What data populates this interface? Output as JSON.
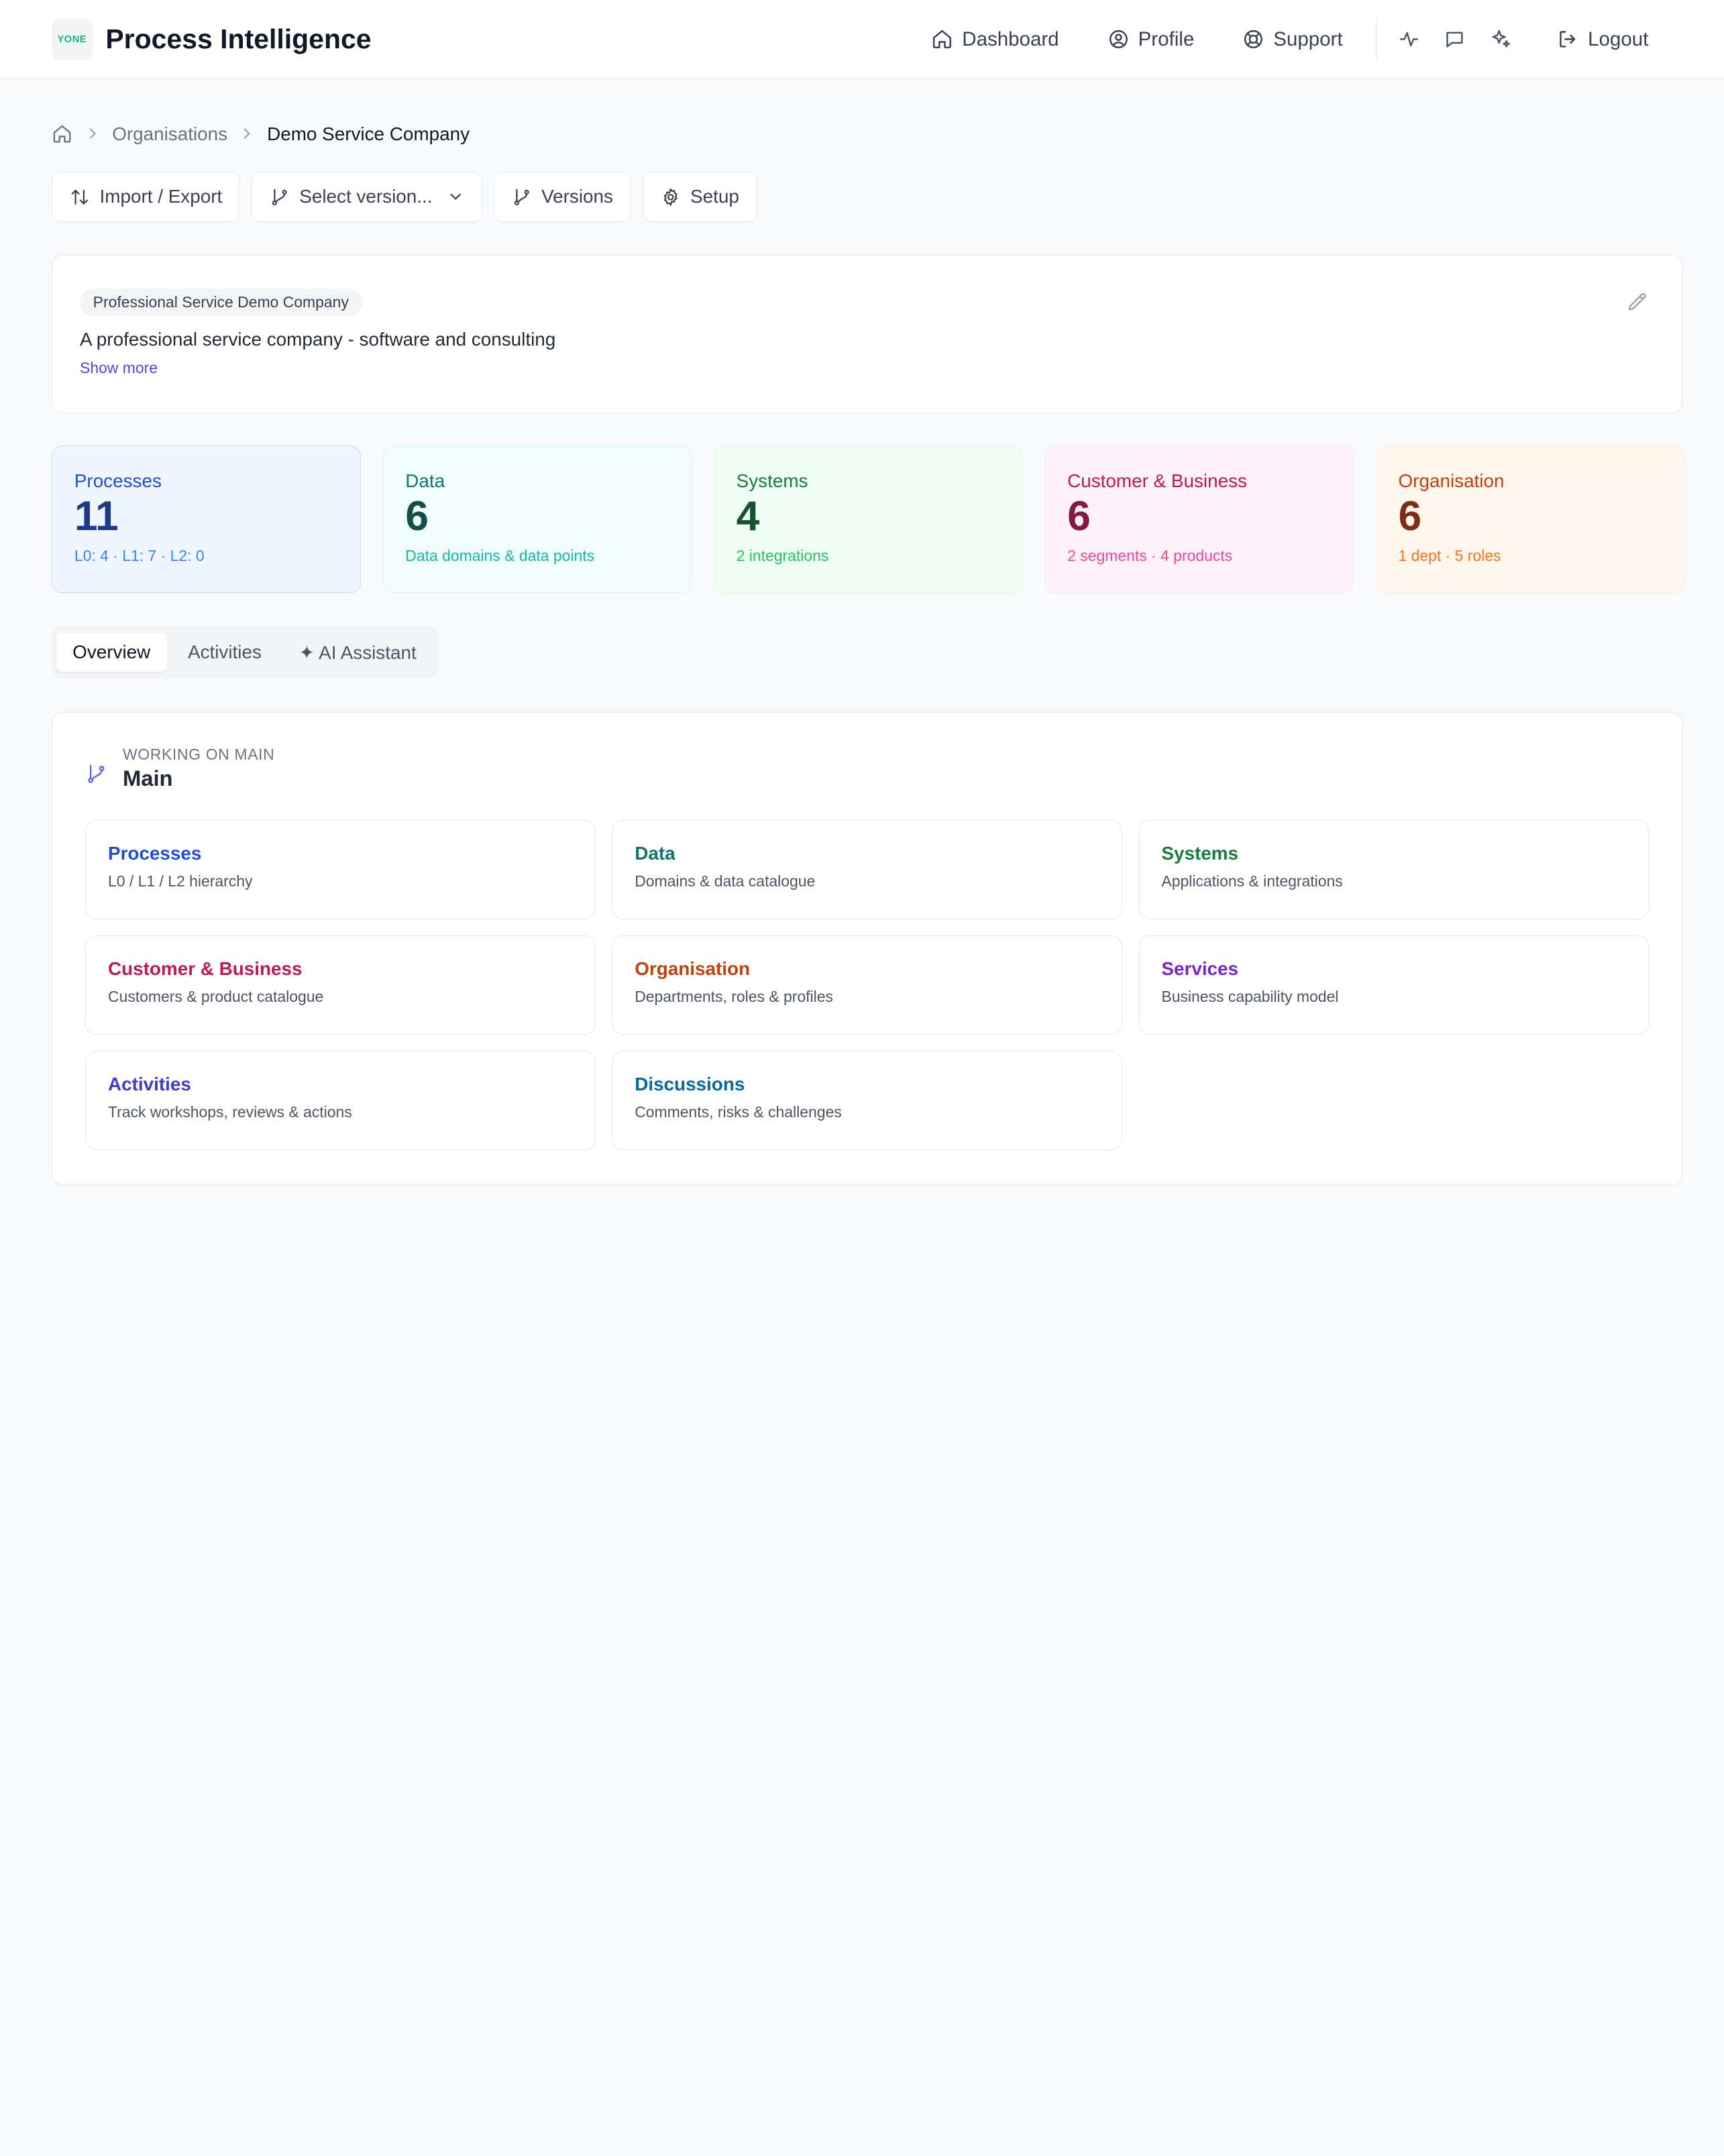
{
  "header": {
    "logo_text": "YONE",
    "title": "Process Intelligence",
    "nav": {
      "dashboard": "Dashboard",
      "profile": "Profile",
      "support": "Support",
      "logout": "Logout"
    }
  },
  "breadcrumb": {
    "organisations": "Organisations",
    "current": "Demo Service Company"
  },
  "toolbar": {
    "import_export": "Import / Export",
    "select_version": "Select version...",
    "versions": "Versions",
    "setup": "Setup"
  },
  "description": {
    "tag": "Professional Service Demo Company",
    "text": "A professional service company - software and consulting",
    "show_more": "Show more"
  },
  "stats": [
    {
      "label": "Processes",
      "value": "11",
      "sub": "L0: 4 · L1: 7 · L2: 0",
      "colors": {
        "bg": "#eff6ff",
        "border": "#bfdbfe",
        "label": "#1d4ed8",
        "value": "#1e3a8a",
        "sub": "#3b82f6"
      }
    },
    {
      "label": "Data",
      "value": "6",
      "sub": "Data domains & data points",
      "colors": {
        "bg": "#f0fdfa",
        "border": "#ccfbf1",
        "label": "#0f766e",
        "value": "#134e4a",
        "sub": "#14b8a6"
      }
    },
    {
      "label": "Systems",
      "value": "4",
      "sub": "2 integrations",
      "colors": {
        "bg": "#f0fdf4",
        "border": "#dcfce7",
        "label": "#15803d",
        "value": "#14532d",
        "sub": "#22c55e"
      }
    },
    {
      "label": "Customer & Business",
      "value": "6",
      "sub": "2 segments · 4 products",
      "colors": {
        "bg": "#fdf2f8",
        "border": "#fce7f3",
        "label": "#be185d",
        "value": "#831843",
        "sub": "#ec4899"
      }
    },
    {
      "label": "Organisation",
      "value": "6",
      "sub": "1 dept · 5 roles",
      "colors": {
        "bg": "#fff7ed",
        "border": "#ffedd5",
        "label": "#c2410c",
        "value": "#7c2d12",
        "sub": "#f97316"
      }
    }
  ],
  "tabs": {
    "overview": "Overview",
    "activities": "Activities",
    "ai_assistant": "✦ AI Assistant"
  },
  "overview": {
    "caption": "WORKING ON MAIN",
    "branch": "Main",
    "tiles": [
      {
        "title": "Processes",
        "sub": "L0 / L1 / L2 hierarchy",
        "color": "#1d4ed8"
      },
      {
        "title": "Data",
        "sub": "Domains & data catalogue",
        "color": "#0f766e"
      },
      {
        "title": "Systems",
        "sub": "Applications & integrations",
        "color": "#15803d"
      },
      {
        "title": "Customer & Business",
        "sub": "Customers & product catalogue",
        "color": "#be185d"
      },
      {
        "title": "Organisation",
        "sub": "Departments, roles & profiles",
        "color": "#c2410c"
      },
      {
        "title": "Services",
        "sub": "Business capability model",
        "color": "#7e22ce"
      },
      {
        "title": "Activities",
        "sub": "Track workshops, reviews & actions",
        "color": "#4338ca"
      },
      {
        "title": "Discussions",
        "sub": "Comments, risks & challenges",
        "color": "#0369a1"
      }
    ]
  }
}
